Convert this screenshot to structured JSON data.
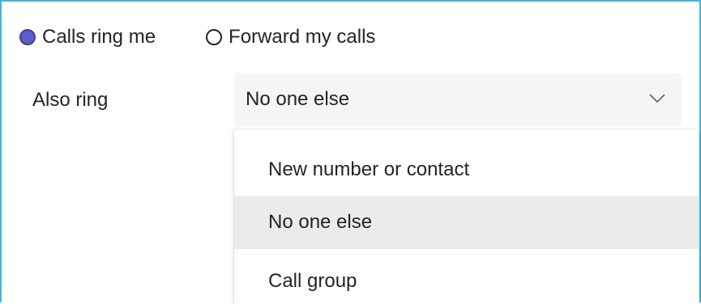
{
  "accent": "#5b5fc7",
  "radios": [
    {
      "label": "Calls ring me",
      "checked": true
    },
    {
      "label": "Forward my calls",
      "checked": false
    }
  ],
  "also_ring": {
    "label": "Also ring",
    "selected": "No one else",
    "chevron_icon": "chevron-down-icon"
  },
  "menu": {
    "items": [
      {
        "label": "New number or contact"
      },
      {
        "label": "No one else",
        "highlighted": true
      },
      {
        "label": "Call group"
      }
    ]
  }
}
